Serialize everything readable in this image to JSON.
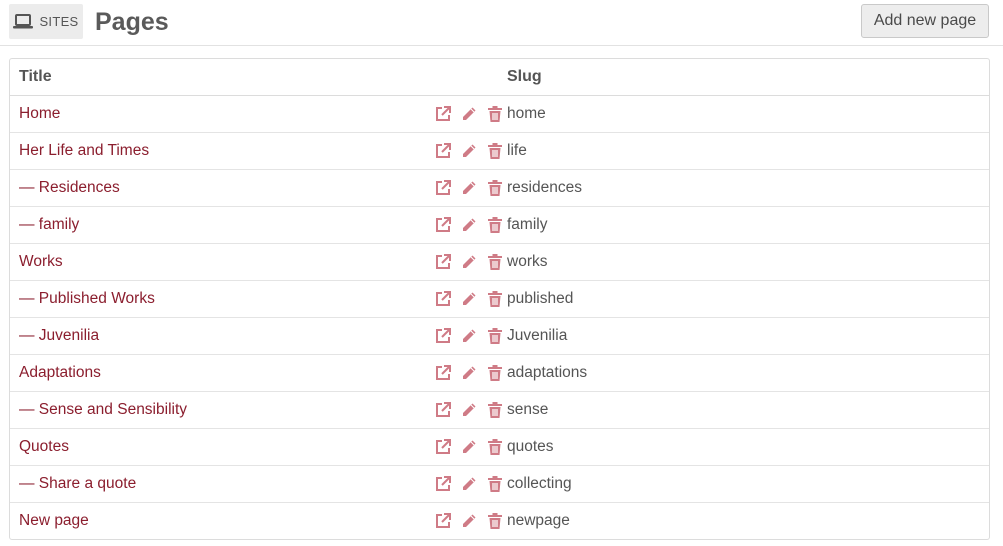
{
  "header": {
    "sites_label": "SITES",
    "title": "Pages",
    "add_button_label": "Add new page"
  },
  "table": {
    "columns": {
      "title": "Title",
      "slug": "Slug"
    },
    "rows": [
      {
        "title": "Home",
        "slug": "home"
      },
      {
        "title": "Her Life and Times",
        "slug": "life"
      },
      {
        "title": "— Residences",
        "slug": "residences"
      },
      {
        "title": "— family",
        "slug": "family"
      },
      {
        "title": "Works",
        "slug": "works"
      },
      {
        "title": "— Published Works",
        "slug": "published"
      },
      {
        "title": "— Juvenilia",
        "slug": "Juvenilia"
      },
      {
        "title": "Adaptations",
        "slug": "adaptations"
      },
      {
        "title": "— Sense and Sensibility",
        "slug": "sense"
      },
      {
        "title": "Quotes",
        "slug": "quotes"
      },
      {
        "title": "— Share a quote",
        "slug": "collecting"
      },
      {
        "title": "New page",
        "slug": "newpage"
      }
    ],
    "row_action_icons": [
      "external-link-icon",
      "pencil-icon",
      "trash-icon"
    ]
  },
  "colors": {
    "link": "#8b1e2e",
    "action_icon": "#cf7b86",
    "text": "#555555"
  }
}
